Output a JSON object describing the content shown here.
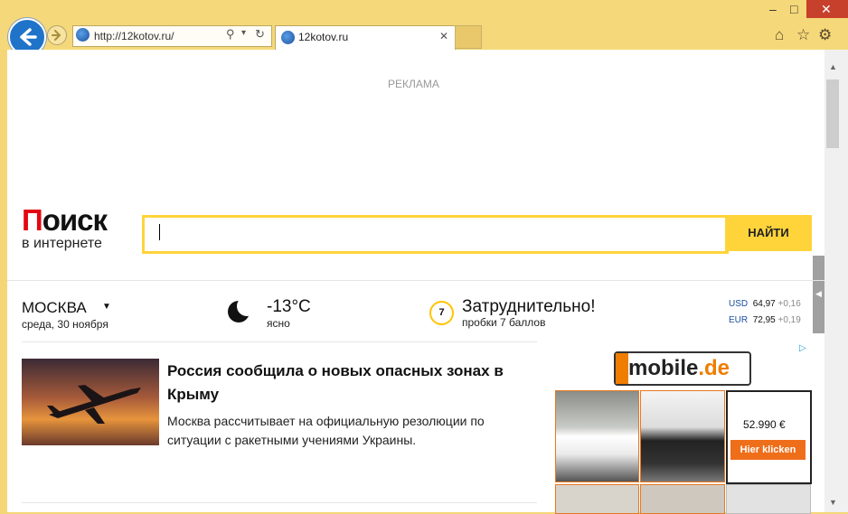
{
  "browser": {
    "url": "http://12kotov.ru/",
    "tab_title": "12kotov.ru",
    "window_controls": [
      "–",
      "□",
      "✕"
    ],
    "toolbar_icons": [
      "home-icon",
      "star-icon",
      "gear-icon"
    ]
  },
  "page": {
    "ad_label": "РЕКЛАМА",
    "logo": {
      "first_letter": "П",
      "rest": "оиск",
      "subtitle": "в интернете"
    },
    "search": {
      "value": "",
      "button_label": "НАЙТИ"
    },
    "location": {
      "city": "МОСКВА",
      "date": "среда, 30 ноября"
    },
    "weather": {
      "temp": "-13°C",
      "condition": "ясно"
    },
    "traffic": {
      "level": "7",
      "title": "Затруднительно!",
      "subtitle": "пробки 7 баллов"
    },
    "currency": [
      {
        "name": "USD",
        "value": "64,97",
        "change": "+0,16"
      },
      {
        "name": "EUR",
        "value": "72,95",
        "change": "+0,19"
      }
    ],
    "news": {
      "title": "Россия сообщила о новых опасных зонах в Крыму",
      "text": "Москва рассчитывает на официальную резолюции по ситуации с ракетными учениями Украины."
    },
    "ad": {
      "brand_part1": "mobile",
      "brand_part2": ".de",
      "price": "52.990 €",
      "cta": "Hier klicken"
    }
  },
  "colors": {
    "accent_yellow": "#ffd43b",
    "logo_red": "#e30613",
    "ad_orange": "#ef6e1a",
    "chrome": "#f5d879"
  }
}
